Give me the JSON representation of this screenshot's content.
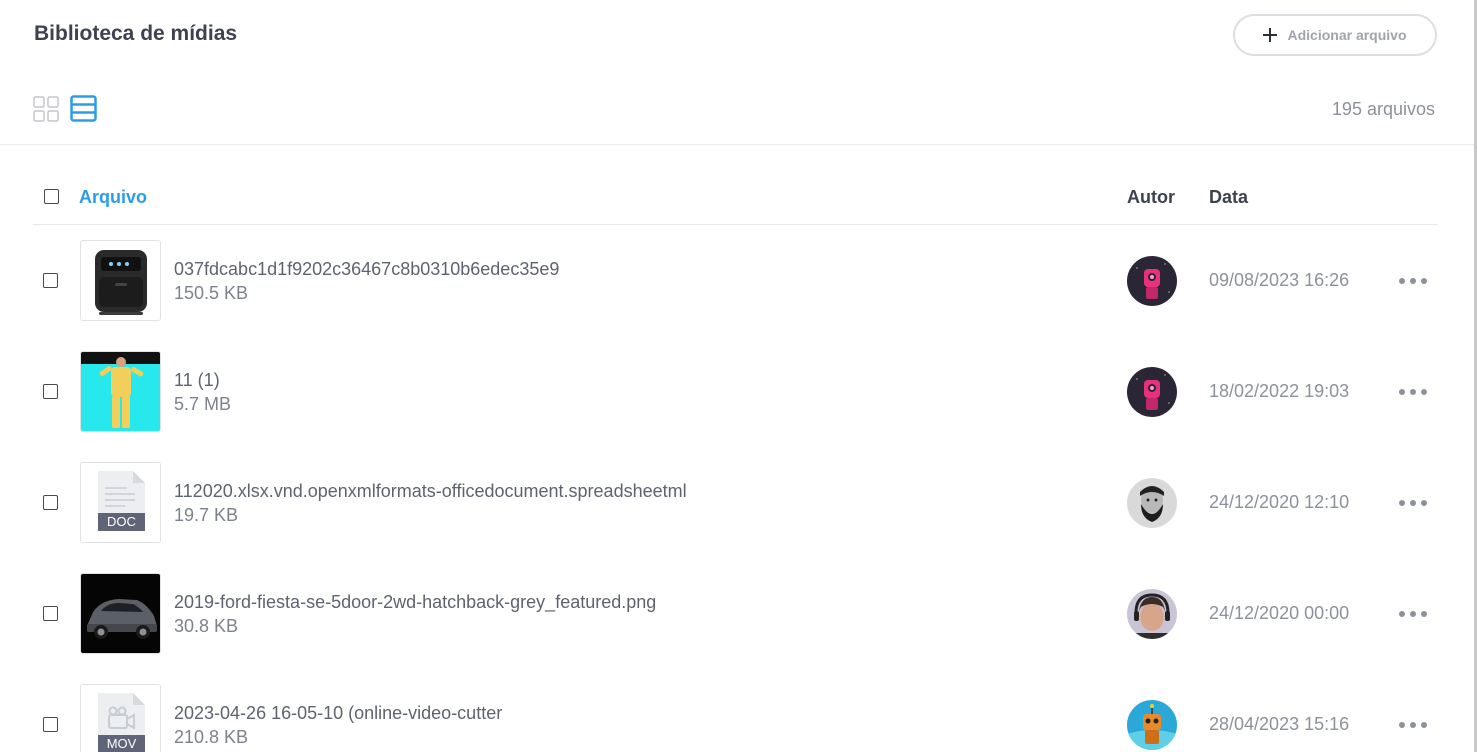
{
  "header": {
    "title": "Biblioteca de mídias",
    "add_button_label": "Adicionar arquivo",
    "file_count": "195 arquivos"
  },
  "table": {
    "columns": {
      "file": "Arquivo",
      "author": "Autor",
      "date": "Data"
    },
    "rows": [
      {
        "name": "037fdcabc1d1f9202c36467c8b0310b6edec35e9",
        "size": "150.5 KB",
        "date": "09/08/2023 16:26",
        "thumb": "air-fryer-image",
        "avatar": "robot-avatar"
      },
      {
        "name": "11 (1)",
        "size": "5.7 MB",
        "date": "18/02/2022 19:03",
        "thumb": "person-yellow-suit-image",
        "avatar": "robot-avatar"
      },
      {
        "name": "112020.xlsx.vnd.openxmlformats-officedocument.spreadsheetml",
        "size": "19.7 KB",
        "date": "24/12/2020 12:10",
        "thumb": "doc-file-icon",
        "thumb_badge": "DOC",
        "avatar": "bearded-man-avatar"
      },
      {
        "name": "2019-ford-fiesta-se-5door-2wd-hatchback-grey_featured.png",
        "size": "30.8 KB",
        "date": "24/12/2020 00:00",
        "thumb": "grey-car-image",
        "avatar": "headset-man-avatar"
      },
      {
        "name": "2023-04-26 16-05-10 (online-video-cutter",
        "size": "210.8 KB",
        "date": "28/04/2023 15:16",
        "thumb": "mov-file-icon",
        "thumb_badge": "MOV",
        "avatar": "orange-robot-avatar"
      }
    ]
  },
  "colors": {
    "accent": "#2b9de8",
    "title": "#3d4250",
    "muted": "#8c919b"
  }
}
